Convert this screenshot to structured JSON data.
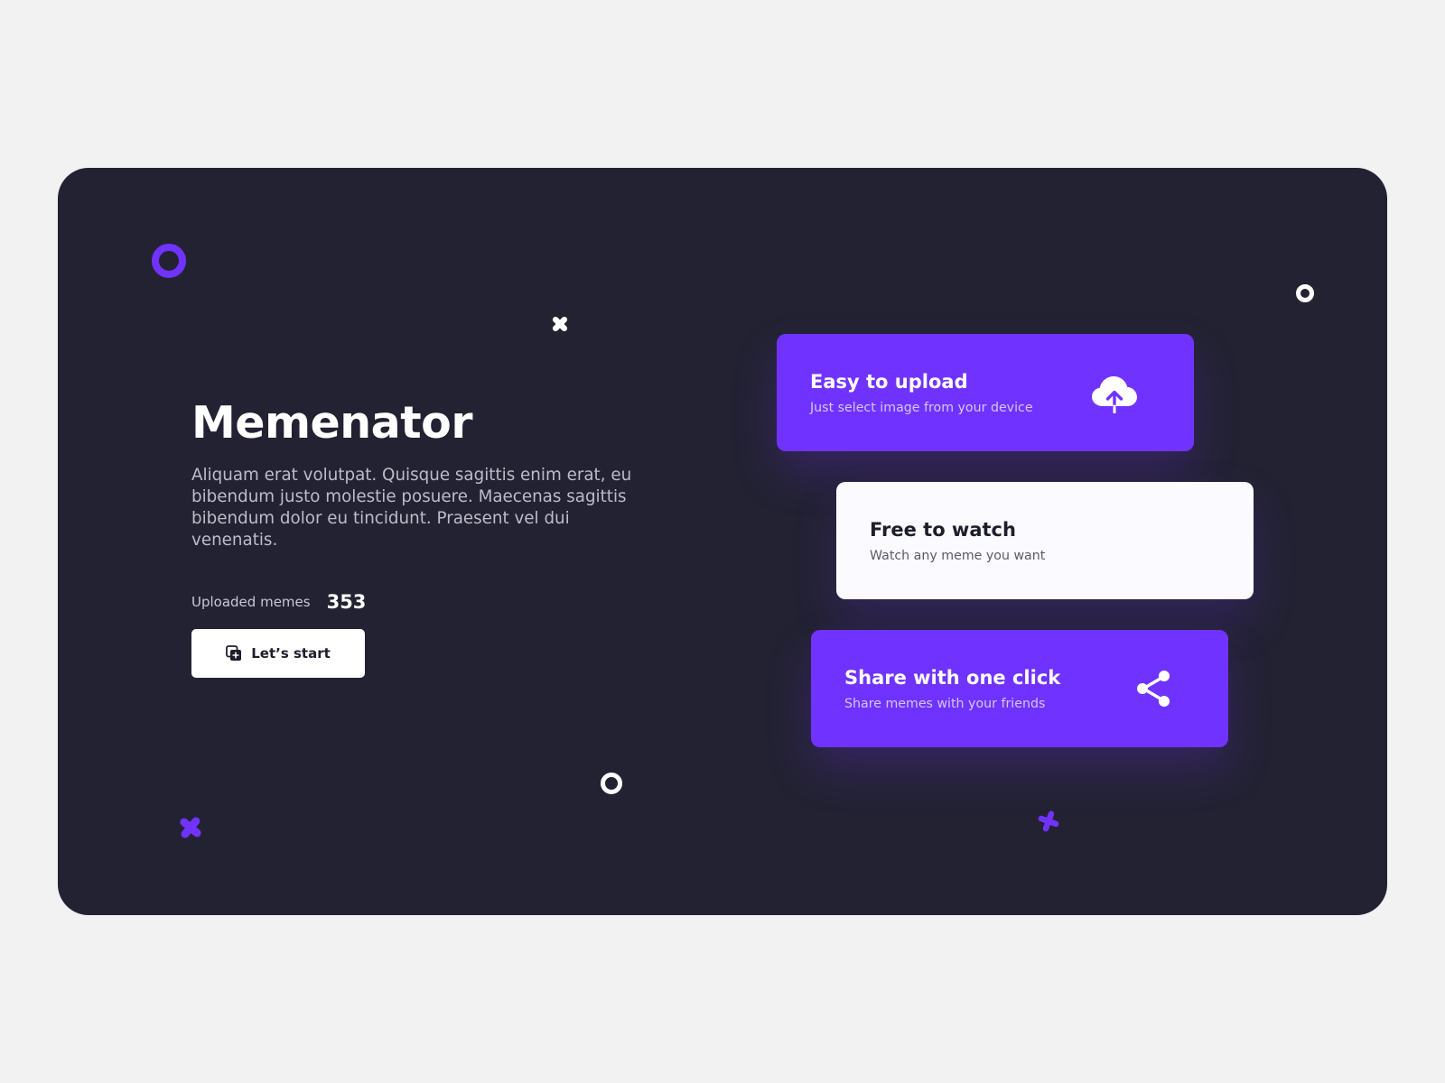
{
  "hero": {
    "title": "Memenator",
    "description": "Aliquam erat volutpat. Quisque sagittis enim erat, eu bibendum justo molestie posuere. Maecenas sagittis bibendum dolor eu tincidunt. Praesent vel dui venenatis.",
    "stats": {
      "label": "Uploaded memes",
      "value": "353"
    },
    "cta": {
      "icon": "add-image-icon",
      "label": "Let’s start"
    }
  },
  "features": [
    {
      "title": "Easy to upload",
      "subtitle": "Just select image from your device",
      "icon": "cloud-upload-icon",
      "style": "purple"
    },
    {
      "title": "Free to watch",
      "subtitle": "Watch any meme you want",
      "icon": "",
      "style": "white"
    },
    {
      "title": "Share with one click",
      "subtitle": "Share memes with your friends",
      "icon": "share-icon",
      "style": "purple"
    }
  ],
  "colors": {
    "page_background": "#f2f2f2",
    "panel_background": "#232232",
    "accent": "#7033ff",
    "card_white": "#fbfbff",
    "text_primary": "#ffffff",
    "text_dark": "#1e1d2c"
  }
}
